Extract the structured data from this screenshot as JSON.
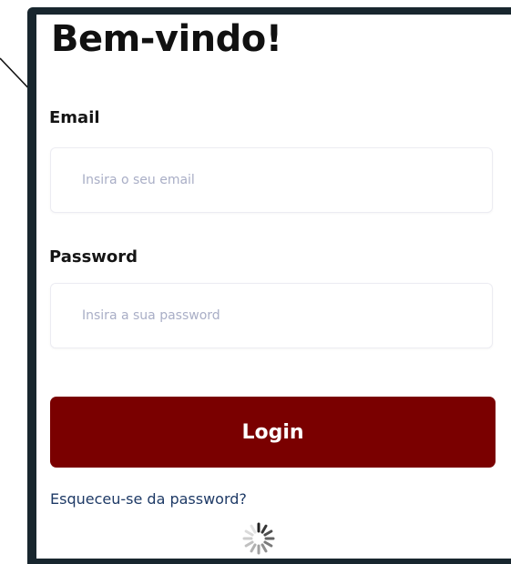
{
  "page": {
    "title": "Bem-vindo!"
  },
  "form": {
    "email": {
      "label": "Email",
      "placeholder": "Insira o seu email",
      "value": ""
    },
    "password": {
      "label": "Password",
      "placeholder": "Insira a sua password",
      "value": ""
    },
    "login_label": "Login",
    "forgot_password_label": "Esqueceu-se da password?"
  },
  "status": {
    "loading": true,
    "spinner_icon": "loading-spinner-icon"
  },
  "colors": {
    "brand_primary": "#7a0000",
    "link": "#1e3a66",
    "placeholder": "#a9aec6",
    "frame": "#18262e"
  }
}
